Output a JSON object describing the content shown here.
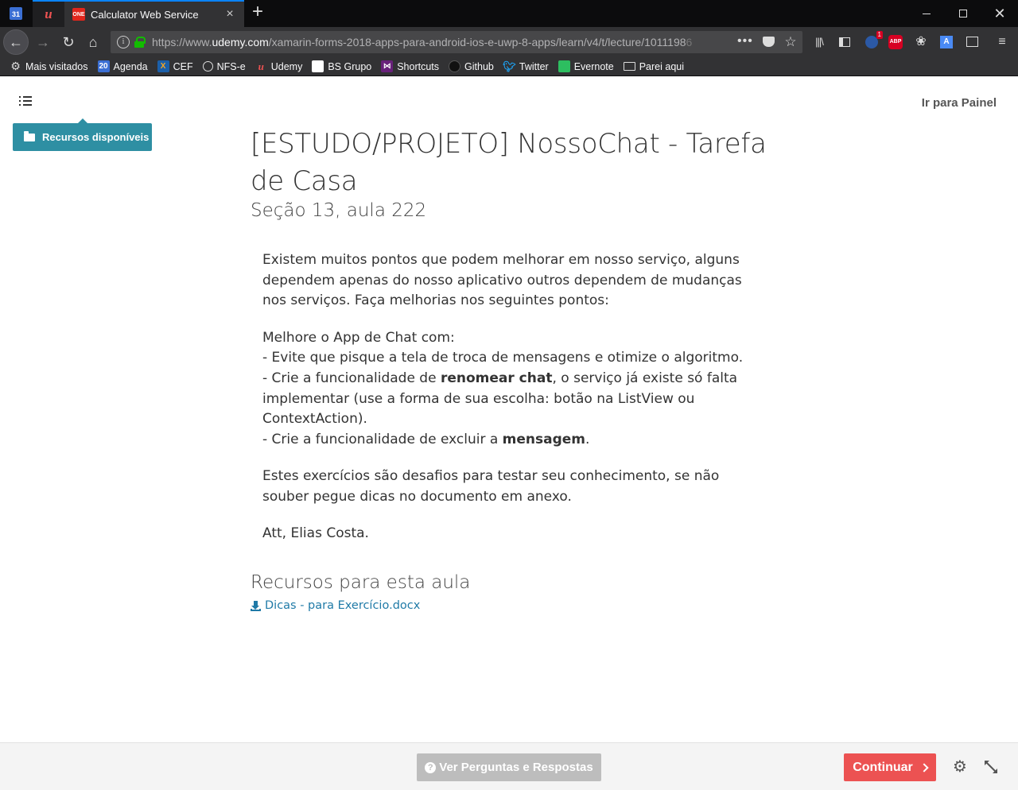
{
  "browser": {
    "pinned_tabs": [
      {
        "name": "Google Calendar",
        "icon": "calendar-icon",
        "label": "31"
      },
      {
        "name": "Udemy",
        "icon": "udemy-icon",
        "label": "u"
      }
    ],
    "active_tab": {
      "title": "Calculator Web Service",
      "favicon_text": "ONE"
    },
    "url": {
      "prefix": "https://www.",
      "domain": "udemy.com",
      "path": "/xamarin-forms-2018-apps-para-android-ios-e-uwp-8-apps/learn/v4/t/lecture/1011198",
      "fade": "6"
    },
    "accent_color": "#0a84ff",
    "bookmarks": [
      {
        "label": "Mais visitados",
        "icon": "gear-icon"
      },
      {
        "label": "Agenda",
        "icon": "calendar-icon",
        "badge": "20"
      },
      {
        "label": "CEF",
        "icon": "cef-icon",
        "badge": "X"
      },
      {
        "label": "NFS-e",
        "icon": "globe-icon"
      },
      {
        "label": "Udemy",
        "icon": "udemy-icon"
      },
      {
        "label": "BS Grupo",
        "icon": "page-icon"
      },
      {
        "label": "Shortcuts",
        "icon": "visualstudio-icon"
      },
      {
        "label": "Github",
        "icon": "github-icon"
      },
      {
        "label": "Twitter",
        "icon": "twitter-icon"
      },
      {
        "label": "Evernote",
        "icon": "evernote-icon"
      },
      {
        "label": "Parei aqui",
        "icon": "folder-icon"
      }
    ],
    "toolbar": {
      "badge_count": "1",
      "abp": "ABP"
    }
  },
  "page": {
    "resources_button": "Recursos disponíveis",
    "dashboard_link": "Ir para Painel",
    "title": "[ESTUDO/PROJETO] NossoChat - Tarefa de Casa",
    "subtitle": "Seção 13, aula 222",
    "body": {
      "p1": "Existem muitos pontos que podem melhorar em nosso serviço, alguns dependem apenas do nosso aplicativo outros dependem de mudanças nos serviços. Faça melhorias nos seguintes pontos:",
      "p2_intro": "Melhore o App de Chat com:",
      "p2_item1": "- Evite que pisque a tela de troca de mensagens e otimize o algoritmo.",
      "p2_item2_a": "- Crie a funcionalidade de ",
      "p2_item2_b": "renomear chat",
      "p2_item2_c": ", o serviço já existe só falta implementar (use a forma de sua escolha: botão na ListView ou ContextAction).",
      "p2_item3_a": "- Crie a funcionalidade de excluir a ",
      "p2_item3_b": "mensagem",
      "p2_item3_c": ".",
      "p3": "Estes exercícios são desafios para testar seu conhecimento, se não souber pegue dicas no documento em anexo.",
      "p4": "Att, Elias Costa."
    },
    "resources_heading": "Recursos para esta aula",
    "resource_file": "Dicas - para Exercício.docx"
  },
  "footer": {
    "qa_button": "Ver Perguntas e Respostas",
    "continue_button": "Continuar",
    "continue_color": "#ec5252"
  }
}
